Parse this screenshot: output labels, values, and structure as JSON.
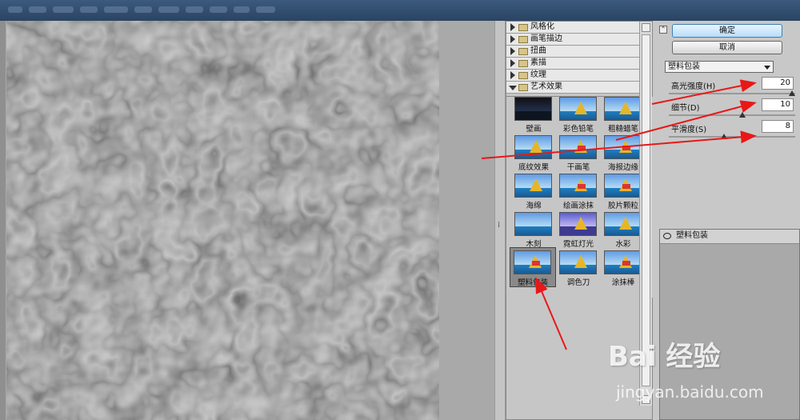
{
  "buttons": {
    "ok": "确定",
    "cancel": "取消"
  },
  "categories": [
    {
      "label": "风格化",
      "open": false
    },
    {
      "label": "画笔描边",
      "open": false
    },
    {
      "label": "扭曲",
      "open": false
    },
    {
      "label": "素描",
      "open": false
    },
    {
      "label": "纹理",
      "open": false
    },
    {
      "label": "艺术效果",
      "open": true
    }
  ],
  "thumbnails": [
    "壁画",
    "彩色铅笔",
    "粗糙蜡笔",
    "底纹效果",
    "干画笔",
    "海报边缘",
    "海绵",
    "绘画涂抹",
    "胶片颗粒",
    "木刻",
    "霓虹灯光",
    "水彩",
    "塑料包装",
    "调色刀",
    "涂抹棒"
  ],
  "selected_filter": "塑料包装",
  "params": [
    {
      "label": "高光强度(H)",
      "value": "20",
      "level": 1.0
    },
    {
      "label": "细节(D)",
      "value": "10",
      "level": 0.6
    },
    {
      "label": "平滑度(S)",
      "value": "8",
      "level": 0.45
    }
  ],
  "layer": {
    "name": "塑料包装"
  },
  "watermark": {
    "logo": "Bai 经验",
    "url": "jingyan.baidu.com"
  },
  "colors": {
    "arrow": "#e81818",
    "ok_accent": "#3d7fb8"
  }
}
